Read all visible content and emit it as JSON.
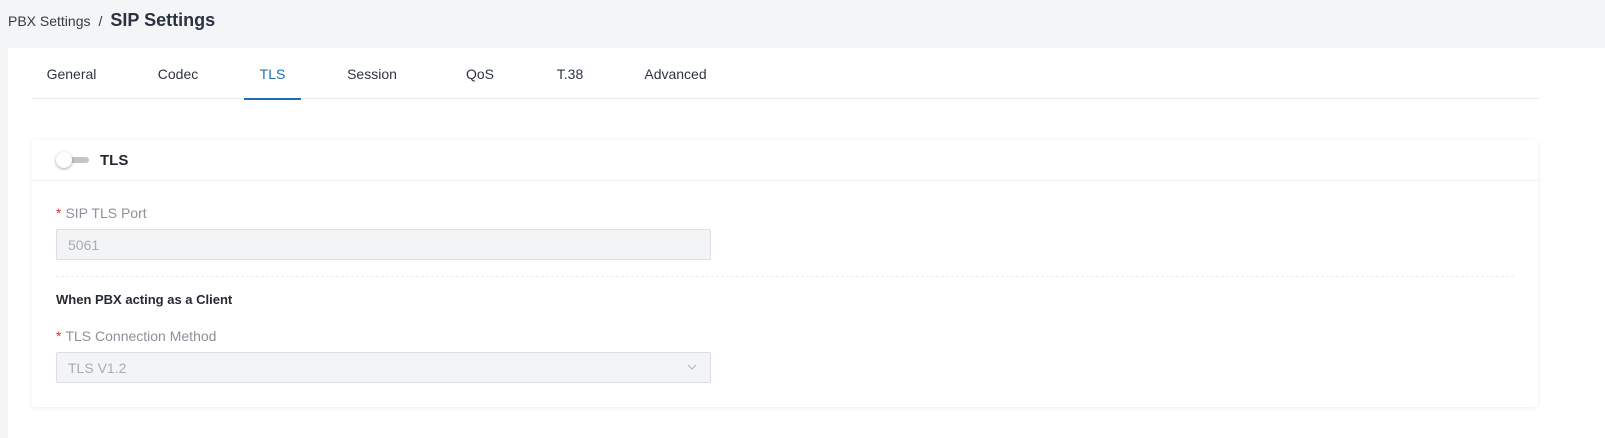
{
  "breadcrumb": {
    "parent": "PBX Settings",
    "separator": "/",
    "current": "SIP Settings"
  },
  "tabs": [
    {
      "label": "General",
      "active": false
    },
    {
      "label": "Codec",
      "active": false
    },
    {
      "label": "TLS",
      "active": true
    },
    {
      "label": "Session",
      "active": false
    },
    {
      "label": "QoS",
      "active": false
    },
    {
      "label": "T.38",
      "active": false
    },
    {
      "label": "Advanced",
      "active": false
    }
  ],
  "tls_card": {
    "title": "TLS",
    "enabled": false,
    "sip_tls_port": {
      "required_mark": "*",
      "label": "SIP TLS Port",
      "value": "5061",
      "disabled": true
    },
    "client_section_title": "When PBX acting as a Client",
    "tls_connection_method": {
      "required_mark": "*",
      "label": "TLS Connection Method",
      "value": "TLS V1.2",
      "disabled": true
    }
  },
  "colors": {
    "accent": "#1f6fb2",
    "required": "#e0341e",
    "toggle_off": "#c2c6cc"
  },
  "icons": {
    "select_arrow": "chevron-down-icon"
  }
}
